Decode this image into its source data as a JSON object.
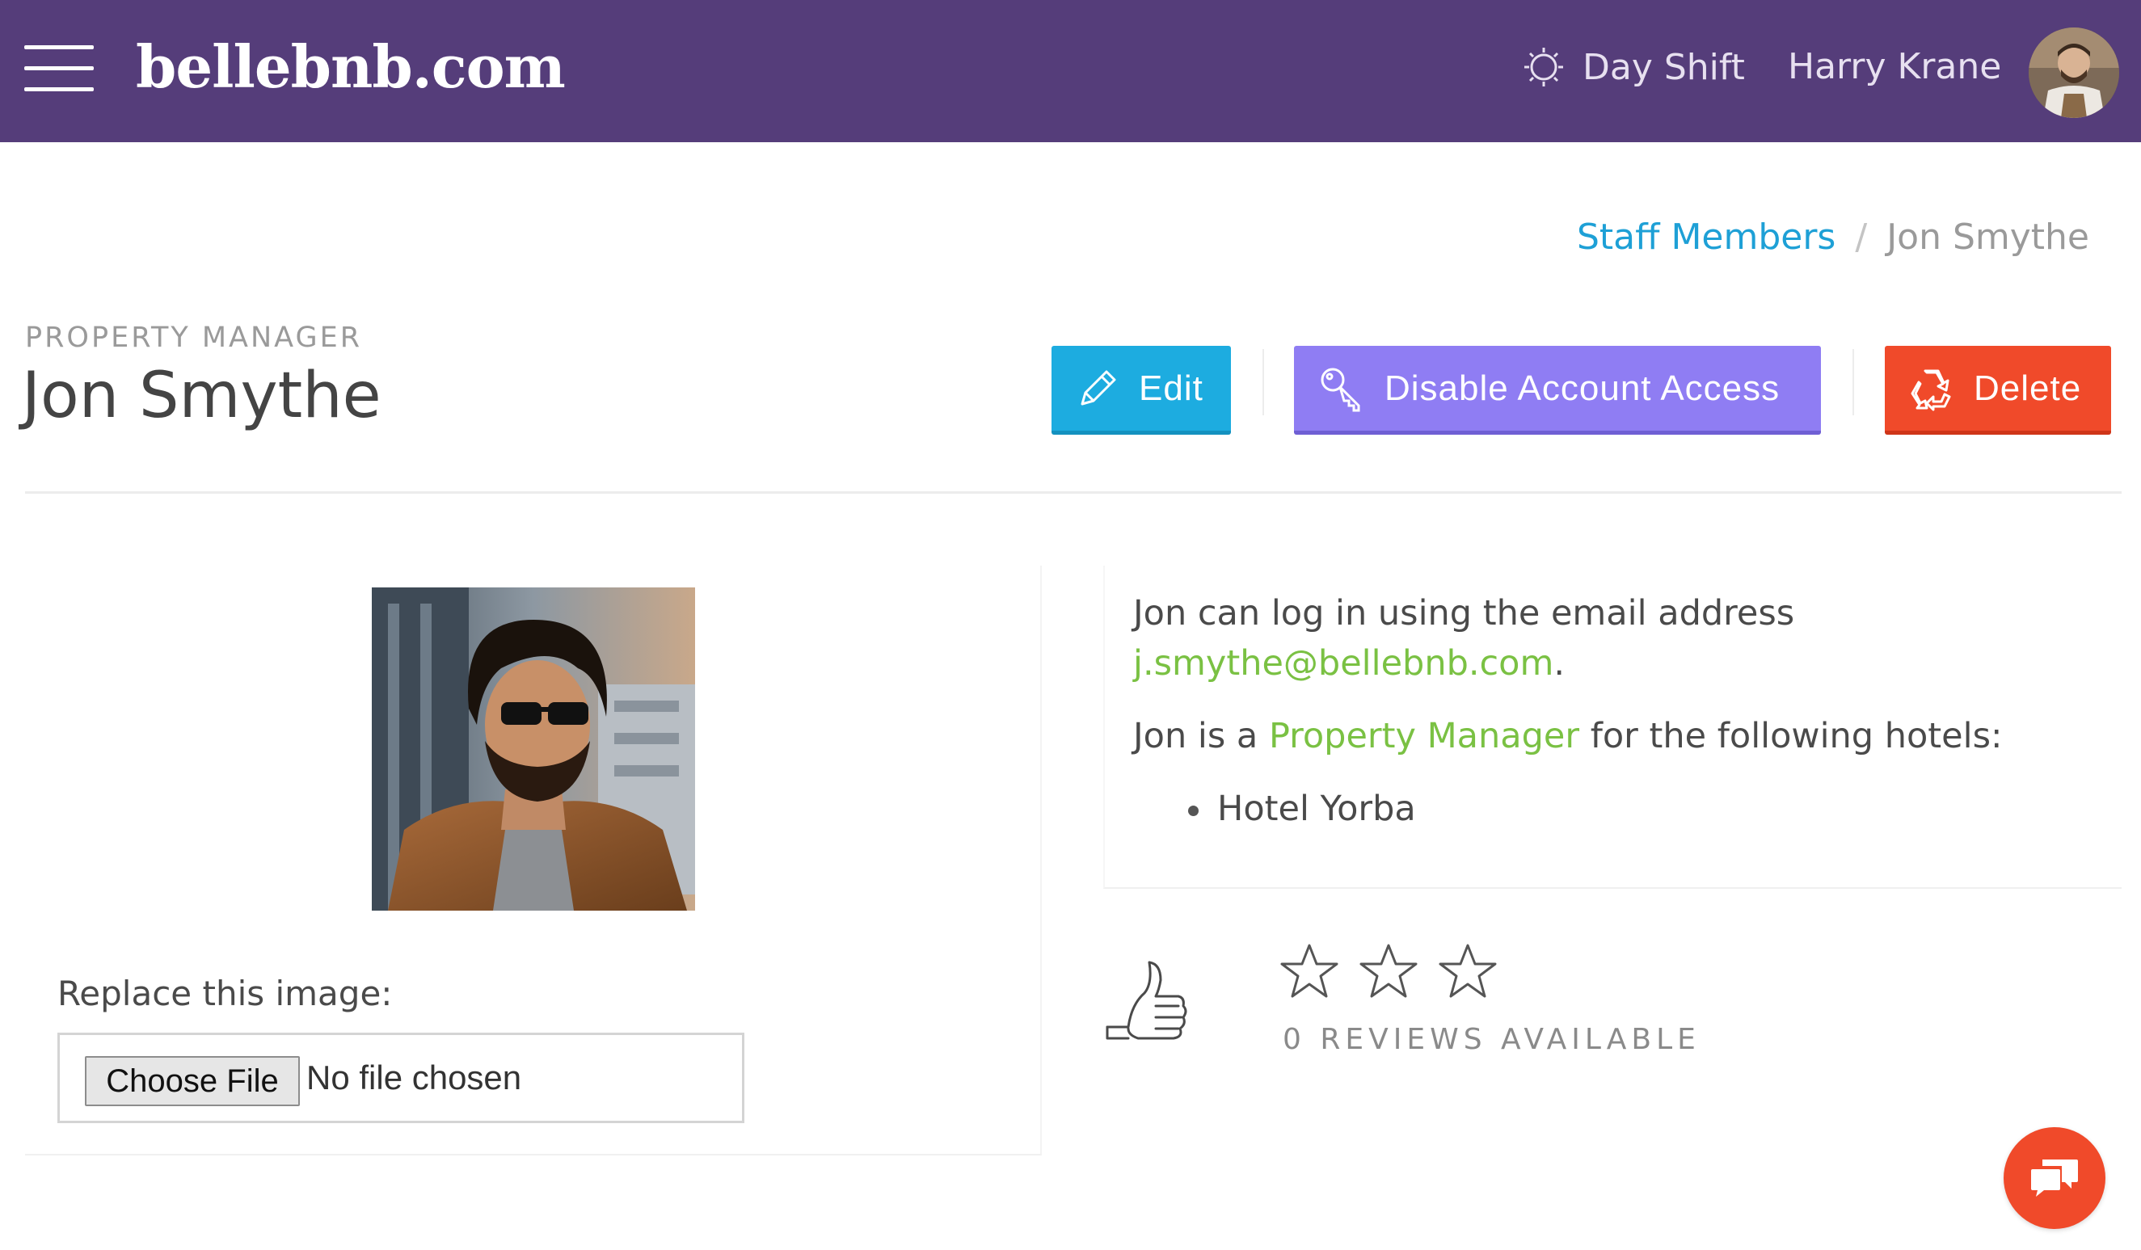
{
  "header": {
    "brand": "bellebnb.com",
    "shift_label": "Day Shift",
    "user_name": "Harry Krane"
  },
  "breadcrumb": {
    "parent": "Staff Members",
    "separator": "/",
    "current": "Jon Smythe"
  },
  "profile": {
    "role": "PROPERTY MANAGER",
    "name": "Jon Smythe"
  },
  "actions": {
    "edit_label": "Edit",
    "disable_label": "Disable Account Access",
    "delete_label": "Delete"
  },
  "upload": {
    "label": "Replace this image:",
    "button_label": "Choose File",
    "status": "No file chosen"
  },
  "info": {
    "login_prefix": "Jon can log in using the email address",
    "email": "j.smythe@bellebnb.com",
    "email_suffix": ".",
    "role_prefix": "Jon is a",
    "role_link": "Property Manager",
    "role_suffix": "for the following hotels:",
    "hotels": [
      "Hotel Yorba"
    ]
  },
  "reviews": {
    "rating": 0,
    "max_rating": 3,
    "text": "0 REVIEWS AVAILABLE"
  },
  "colors": {
    "header_bg": "#553d7a",
    "edit": "#1dace0",
    "disable": "#8f7df3",
    "delete": "#f04a2a",
    "link_blue": "#1ea0d6",
    "link_green": "#7ac143"
  },
  "icons": [
    "menu-icon",
    "sun-icon",
    "pencil-icon",
    "key-icon",
    "recycle-icon",
    "thumbs-up-icon",
    "star-icon",
    "chat-icon"
  ]
}
